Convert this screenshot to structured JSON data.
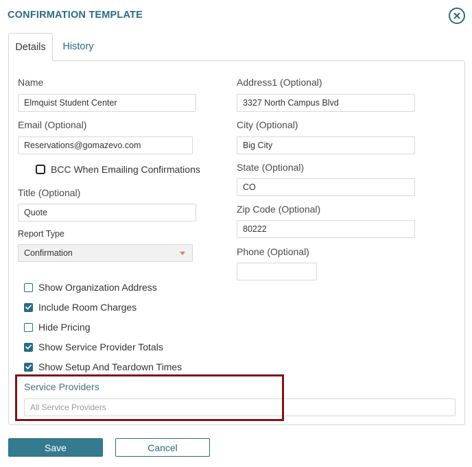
{
  "dialog": {
    "title": "CONFIRMATION TEMPLATE",
    "close_icon": "close-circle-icon"
  },
  "tabs": [
    {
      "label": "Details",
      "active": true
    },
    {
      "label": "History",
      "active": false
    }
  ],
  "form": {
    "name": {
      "label": "Name",
      "value": "Elmquist Student Center"
    },
    "email": {
      "label": "Email (Optional)",
      "value": "Reservations@gomazevo.com"
    },
    "bcc": {
      "label": "BCC When Emailing Confirmations",
      "checked": false
    },
    "title": {
      "label": "Title (Optional)",
      "value": "Quote"
    },
    "report_type": {
      "label": "Report Type",
      "value": "Confirmation"
    },
    "address1": {
      "label": "Address1 (Optional)",
      "value": "3327 North Campus Blvd"
    },
    "city": {
      "label": "City (Optional)",
      "value": "Big City"
    },
    "state": {
      "label": "State (Optional)",
      "value": "CO"
    },
    "zip": {
      "label": "Zip Code (Optional)",
      "value": "80222"
    },
    "phone": {
      "label": "Phone (Optional)",
      "value": ""
    },
    "options": [
      {
        "label": "Show Organization Address",
        "checked": false
      },
      {
        "label": "Include Room Charges",
        "checked": true
      },
      {
        "label": "Hide Pricing",
        "checked": false
      },
      {
        "label": "Show Service Provider Totals",
        "checked": true
      },
      {
        "label": "Show Setup And Teardown Times",
        "checked": true
      }
    ],
    "service_providers": {
      "label": "Service Providers",
      "placeholder": "All Service Providers"
    }
  },
  "buttons": {
    "save": "Save",
    "cancel": "Cancel"
  },
  "colors": {
    "accent": "#2b6b82",
    "highlight": "#7f1517",
    "caret": "#e0804a"
  }
}
